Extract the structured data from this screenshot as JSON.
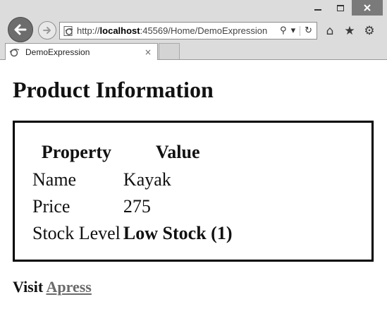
{
  "browser": {
    "url_prefix": "http://",
    "url_host": "localhost",
    "url_rest": ":45569/Home/DemoExpression",
    "tab_title": "DemoExpression",
    "tab_close": "×",
    "icons": {
      "back": "back-arrow-icon",
      "forward": "forward-arrow-icon",
      "search": "⚲",
      "refresh": "↻",
      "home": "⌂",
      "favorites": "★",
      "settings": "⚙"
    }
  },
  "page": {
    "heading": "Product Information",
    "table": {
      "headers": [
        "Property",
        "Value"
      ],
      "rows": [
        {
          "property": "Name",
          "value": "Kayak"
        },
        {
          "property": "Price",
          "value": "275"
        },
        {
          "property": "Stock Level",
          "value": "Low Stock (1)"
        }
      ]
    },
    "visit_label": "Visit",
    "link_text": "Apress"
  }
}
